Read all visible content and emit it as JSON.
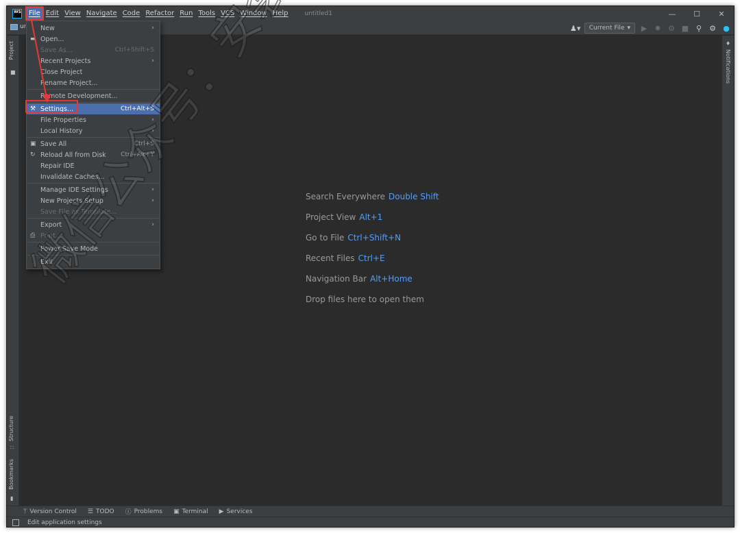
{
  "app": {
    "logo_text": "WS",
    "window_title": "untitled1"
  },
  "menubar": [
    "File",
    "Edit",
    "View",
    "Navigate",
    "Code",
    "Refactor",
    "Run",
    "Tools",
    "VCS",
    "Window",
    "Help"
  ],
  "toolbar": {
    "project_label": "ur",
    "run_config": "Current File"
  },
  "left_stripe": {
    "project_tab": "Project",
    "structure_tab": "Structure",
    "bookmarks_tab": "Bookmarks"
  },
  "right_stripe": {
    "notifications_tab": "Notifications"
  },
  "file_menu": [
    {
      "label": "New",
      "shortcut": "",
      "submenu": true,
      "disabled": false,
      "icon": ""
    },
    {
      "label": "Open...",
      "shortcut": "",
      "submenu": false,
      "disabled": false,
      "icon": "folder-open-icon"
    },
    {
      "label": "Save As...",
      "shortcut": "Ctrl+Shift+S",
      "submenu": false,
      "disabled": true,
      "icon": ""
    },
    {
      "label": "Recent Projects",
      "shortcut": "",
      "submenu": true,
      "disabled": false,
      "icon": ""
    },
    {
      "label": "Close Project",
      "shortcut": "",
      "submenu": false,
      "disabled": false,
      "icon": ""
    },
    {
      "label": "Rename Project...",
      "shortcut": "",
      "submenu": false,
      "disabled": false,
      "icon": ""
    },
    {
      "sep": true
    },
    {
      "label": "Remote Development...",
      "shortcut": "",
      "submenu": false,
      "disabled": false,
      "icon": ""
    },
    {
      "sep": true
    },
    {
      "label": "Settings...",
      "shortcut": "Ctrl+Alt+S",
      "submenu": false,
      "disabled": false,
      "icon": "wrench-icon",
      "selected": true
    },
    {
      "label": "File Properties",
      "shortcut": "",
      "submenu": true,
      "disabled": false,
      "icon": ""
    },
    {
      "label": "Local History",
      "shortcut": "",
      "submenu": true,
      "disabled": false,
      "icon": ""
    },
    {
      "sep": true
    },
    {
      "label": "Save All",
      "shortcut": "Ctrl+S",
      "submenu": false,
      "disabled": false,
      "icon": "save-icon"
    },
    {
      "label": "Reload All from Disk",
      "shortcut": "Ctrl+Alt+Y",
      "submenu": false,
      "disabled": false,
      "icon": "reload-icon"
    },
    {
      "label": "Repair IDE",
      "shortcut": "",
      "submenu": false,
      "disabled": false,
      "icon": ""
    },
    {
      "label": "Invalidate Caches...",
      "shortcut": "",
      "submenu": false,
      "disabled": false,
      "icon": ""
    },
    {
      "sep": true
    },
    {
      "label": "Manage IDE Settings",
      "shortcut": "",
      "submenu": true,
      "disabled": false,
      "icon": ""
    },
    {
      "label": "New Projects Setup",
      "shortcut": "",
      "submenu": true,
      "disabled": false,
      "icon": ""
    },
    {
      "label": "Save File as Template...",
      "shortcut": "",
      "submenu": false,
      "disabled": true,
      "icon": ""
    },
    {
      "sep": true
    },
    {
      "label": "Export",
      "shortcut": "",
      "submenu": true,
      "disabled": false,
      "icon": ""
    },
    {
      "label": "Print...",
      "shortcut": "",
      "submenu": false,
      "disabled": true,
      "icon": "print-icon"
    },
    {
      "sep": true
    },
    {
      "label": "Power Save Mode",
      "shortcut": "",
      "submenu": false,
      "disabled": false,
      "icon": ""
    },
    {
      "sep": true
    },
    {
      "label": "Exit",
      "shortcut": "",
      "submenu": false,
      "disabled": false,
      "icon": ""
    }
  ],
  "hints": [
    {
      "text": "Search Everywhere",
      "key": "Double Shift"
    },
    {
      "text": "Project View",
      "key": "Alt+1"
    },
    {
      "text": "Go to File",
      "key": "Ctrl+Shift+N"
    },
    {
      "text": "Recent Files",
      "key": "Ctrl+E"
    },
    {
      "text": "Navigation Bar",
      "key": "Alt+Home"
    },
    {
      "text": "Drop files here to open them",
      "key": ""
    }
  ],
  "tool_windows": [
    {
      "label": "Version Control",
      "icon": "branch-icon"
    },
    {
      "label": "TODO",
      "icon": "list-icon"
    },
    {
      "label": "Problems",
      "icon": "info-icon"
    },
    {
      "label": "Terminal",
      "icon": "terminal-icon"
    },
    {
      "label": "Services",
      "icon": "play-circle-icon"
    }
  ],
  "status": {
    "message": "Edit application settings"
  },
  "watermark": "微信公众号：安装软件指南",
  "colors": {
    "accent": "#4b6eaf",
    "link": "#589df6",
    "annotation": "#e53935"
  }
}
